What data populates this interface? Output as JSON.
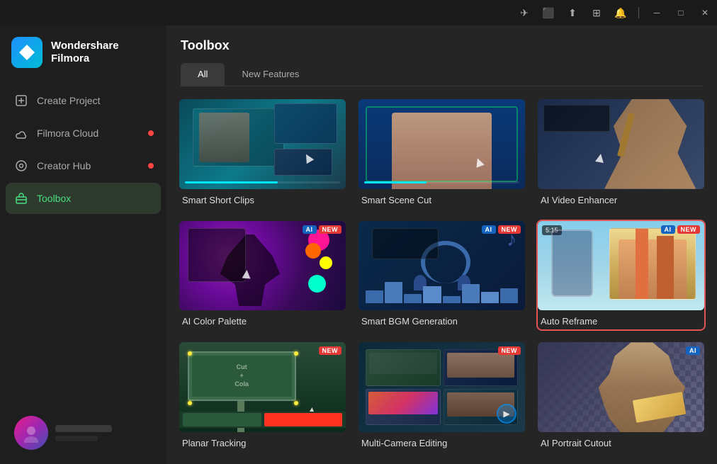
{
  "app": {
    "name": "Wondershare",
    "subtitle": "Filmora"
  },
  "titlebar": {
    "icons": [
      {
        "name": "send-icon",
        "glyph": "✈"
      },
      {
        "name": "monitor-icon",
        "glyph": "🖥"
      },
      {
        "name": "upload-icon",
        "glyph": "⬆"
      },
      {
        "name": "grid-icon",
        "glyph": "⊞"
      },
      {
        "name": "bell-icon",
        "glyph": "🔔"
      }
    ],
    "controls": [
      {
        "name": "minimize-button",
        "glyph": "─"
      },
      {
        "name": "maximize-button",
        "glyph": "□"
      },
      {
        "name": "close-button",
        "glyph": "✕"
      }
    ]
  },
  "sidebar": {
    "nav_items": [
      {
        "id": "create-project",
        "label": "Create Project",
        "icon": "＋",
        "active": false,
        "badge": false
      },
      {
        "id": "filmora-cloud",
        "label": "Filmora Cloud",
        "icon": "☁",
        "active": false,
        "badge": true
      },
      {
        "id": "creator-hub",
        "label": "Creator Hub",
        "icon": "◎",
        "active": false,
        "badge": true
      },
      {
        "id": "toolbox",
        "label": "Toolbox",
        "icon": "🧰",
        "active": true,
        "badge": false
      }
    ]
  },
  "content": {
    "title": "Toolbox",
    "tabs": [
      {
        "id": "all",
        "label": "All",
        "active": true
      },
      {
        "id": "new-features",
        "label": "New Features",
        "active": false
      }
    ],
    "tools": [
      {
        "id": "smart-short-clips",
        "label": "Smart Short Clips",
        "thumb_class": "thumb-ssc",
        "badges": [],
        "selected": false
      },
      {
        "id": "smart-scene-cut",
        "label": "Smart Scene Cut",
        "thumb_class": "thumb-ssc2",
        "badges": [],
        "selected": false
      },
      {
        "id": "ai-video-enhancer",
        "label": "AI Video Enhancer",
        "thumb_class": "thumb-ssc3",
        "badges": [],
        "selected": false
      },
      {
        "id": "ai-color-palette",
        "label": "AI Color Palette",
        "thumb_class": "thumb-acp",
        "badges": [
          "AI",
          "NEW"
        ],
        "selected": false
      },
      {
        "id": "smart-bgm-generation",
        "label": "Smart BGM Generation",
        "thumb_class": "thumb-bgm",
        "badges": [
          "AI",
          "NEW"
        ],
        "selected": false
      },
      {
        "id": "auto-reframe",
        "label": "Auto Reframe",
        "thumb_class": "thumb-ar",
        "badges": [
          "AI",
          "NEW"
        ],
        "selected": true
      },
      {
        "id": "planar-tracking",
        "label": "Planar Tracking",
        "thumb_class": "thumb-pt",
        "badges": [
          "NEW"
        ],
        "selected": false
      },
      {
        "id": "multi-camera-editing",
        "label": "Multi-Camera Editing",
        "thumb_class": "thumb-mce",
        "badges": [
          "NEW"
        ],
        "selected": false
      },
      {
        "id": "ai-portrait-cutout",
        "label": "AI Portrait Cutout",
        "thumb_class": "thumb-apc",
        "badges": [
          "AI"
        ],
        "selected": false
      }
    ]
  }
}
